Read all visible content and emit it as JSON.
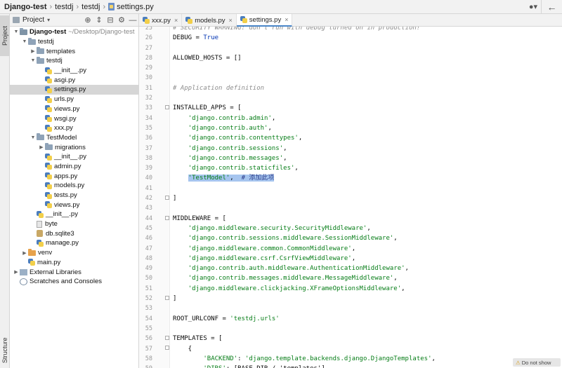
{
  "breadcrumb": [
    {
      "label": "Django-test",
      "bold": true
    },
    {
      "label": "testdj"
    },
    {
      "label": "testdj"
    },
    {
      "label": "settings.py",
      "file": true
    }
  ],
  "stripe": {
    "project_tab": "Project",
    "structure_tab": "Structure"
  },
  "panel": {
    "title": "Project"
  },
  "tree": [
    {
      "depth": 0,
      "arrow": "down",
      "icon": "folder-dark",
      "label": "Django-test",
      "bold": true,
      "path": "~/Desktop/Django-test"
    },
    {
      "depth": 1,
      "arrow": "down",
      "icon": "folder",
      "label": "testdj"
    },
    {
      "depth": 2,
      "arrow": "right",
      "icon": "folder",
      "label": "templates"
    },
    {
      "depth": 2,
      "arrow": "down",
      "icon": "folder",
      "label": "testdj"
    },
    {
      "depth": 3,
      "arrow": "none",
      "icon": "py",
      "label": "__init__.py"
    },
    {
      "depth": 3,
      "arrow": "none",
      "icon": "py",
      "label": "asgi.py"
    },
    {
      "depth": 3,
      "arrow": "none",
      "icon": "py",
      "label": "settings.py",
      "selected": true
    },
    {
      "depth": 3,
      "arrow": "none",
      "icon": "py",
      "label": "urls.py"
    },
    {
      "depth": 3,
      "arrow": "none",
      "icon": "py",
      "label": "views.py"
    },
    {
      "depth": 3,
      "arrow": "none",
      "icon": "py",
      "label": "wsgi.py"
    },
    {
      "depth": 3,
      "arrow": "none",
      "icon": "py",
      "label": "xxx.py"
    },
    {
      "depth": 2,
      "arrow": "down",
      "icon": "folder",
      "label": "TestModel"
    },
    {
      "depth": 3,
      "arrow": "right",
      "icon": "folder",
      "label": "migrations"
    },
    {
      "depth": 3,
      "arrow": "none",
      "icon": "py",
      "label": "__init__.py"
    },
    {
      "depth": 3,
      "arrow": "none",
      "icon": "py",
      "label": "admin.py"
    },
    {
      "depth": 3,
      "arrow": "none",
      "icon": "py",
      "label": "apps.py"
    },
    {
      "depth": 3,
      "arrow": "none",
      "icon": "py",
      "label": "models.py"
    },
    {
      "depth": 3,
      "arrow": "none",
      "icon": "py",
      "label": "tests.py"
    },
    {
      "depth": 3,
      "arrow": "none",
      "icon": "py",
      "label": "views.py"
    },
    {
      "depth": 2,
      "arrow": "none",
      "icon": "py",
      "label": "__init__.py"
    },
    {
      "depth": 2,
      "arrow": "none",
      "icon": "file",
      "label": "byte"
    },
    {
      "depth": 2,
      "arrow": "none",
      "icon": "db",
      "label": "db.sqlite3"
    },
    {
      "depth": 2,
      "arrow": "none",
      "icon": "py",
      "label": "manage.py"
    },
    {
      "depth": 1,
      "arrow": "right",
      "icon": "folder-excluded",
      "label": "venv"
    },
    {
      "depth": 1,
      "arrow": "none",
      "icon": "py",
      "label": "main.py"
    },
    {
      "depth": 0,
      "arrow": "right",
      "icon": "lib",
      "label": "External Libraries"
    },
    {
      "depth": 0,
      "arrow": "none",
      "icon": "scratch",
      "label": "Scratches and Consoles"
    }
  ],
  "tabs": [
    {
      "label": "xxx.py"
    },
    {
      "label": "models.py"
    },
    {
      "label": "settings.py",
      "active": true
    }
  ],
  "editor": {
    "lines": [
      {
        "n": "25",
        "parts": [
          [
            "cmt",
            "# SECURITY WARNING: don't run with debug turned on in production!"
          ]
        ]
      },
      {
        "n": "26",
        "parts": [
          [
            "",
            "DEBUG = "
          ],
          [
            "kw",
            "True"
          ]
        ]
      },
      {
        "n": "27",
        "parts": []
      },
      {
        "n": "28",
        "parts": [
          [
            "",
            "ALLOWED_HOSTS = []"
          ]
        ]
      },
      {
        "n": "29",
        "parts": []
      },
      {
        "n": "30",
        "parts": []
      },
      {
        "n": "31",
        "parts": [
          [
            "cmt",
            "# Application definition"
          ]
        ]
      },
      {
        "n": "32",
        "parts": []
      },
      {
        "n": "33",
        "parts": [
          [
            "",
            "INSTALLED_APPS = ["
          ]
        ]
      },
      {
        "n": "34",
        "parts": [
          [
            "",
            "    "
          ],
          [
            "str",
            "'django.contrib.admin'"
          ],
          [
            "",
            ","
          ]
        ]
      },
      {
        "n": "35",
        "parts": [
          [
            "",
            "    "
          ],
          [
            "str",
            "'django.contrib.auth'"
          ],
          [
            "",
            ","
          ]
        ]
      },
      {
        "n": "36",
        "parts": [
          [
            "",
            "    "
          ],
          [
            "str",
            "'django.contrib.contenttypes'"
          ],
          [
            "",
            ","
          ]
        ]
      },
      {
        "n": "37",
        "parts": [
          [
            "",
            "    "
          ],
          [
            "str",
            "'django.contrib.sessions'"
          ],
          [
            "",
            ","
          ]
        ]
      },
      {
        "n": "38",
        "parts": [
          [
            "",
            "    "
          ],
          [
            "str",
            "'django.contrib.messages'"
          ],
          [
            "",
            ","
          ]
        ]
      },
      {
        "n": "39",
        "parts": [
          [
            "",
            "    "
          ],
          [
            "str",
            "'django.contrib.staticfiles'"
          ],
          [
            "",
            ","
          ]
        ]
      },
      {
        "n": "40",
        "highlight": true,
        "parts": [
          [
            "",
            "    "
          ],
          [
            "hlstart",
            ""
          ],
          [
            "str",
            "'TestModel'"
          ],
          [
            "",
            ",  "
          ],
          [
            "cmt",
            "# 添加此项"
          ]
        ]
      },
      {
        "n": "41",
        "parts": []
      },
      {
        "n": "42",
        "parts": [
          [
            "",
            "]"
          ]
        ]
      },
      {
        "n": "43",
        "parts": []
      },
      {
        "n": "44",
        "parts": [
          [
            "",
            "MIDDLEWARE = ["
          ]
        ]
      },
      {
        "n": "45",
        "parts": [
          [
            "",
            "    "
          ],
          [
            "str",
            "'django.middleware.security.SecurityMiddleware'"
          ],
          [
            "",
            ","
          ]
        ]
      },
      {
        "n": "46",
        "parts": [
          [
            "",
            "    "
          ],
          [
            "str",
            "'django.contrib.sessions.middleware.SessionMiddleware'"
          ],
          [
            "",
            ","
          ]
        ]
      },
      {
        "n": "47",
        "parts": [
          [
            "",
            "    "
          ],
          [
            "str",
            "'django.middleware.common.CommonMiddleware'"
          ],
          [
            "",
            ","
          ]
        ]
      },
      {
        "n": "48",
        "parts": [
          [
            "",
            "    "
          ],
          [
            "str",
            "'django.middleware.csrf.CsrfViewMiddleware'"
          ],
          [
            "",
            ","
          ]
        ]
      },
      {
        "n": "49",
        "parts": [
          [
            "",
            "    "
          ],
          [
            "str",
            "'django.contrib.auth.middleware.AuthenticationMiddleware'"
          ],
          [
            "",
            ","
          ]
        ]
      },
      {
        "n": "50",
        "parts": [
          [
            "",
            "    "
          ],
          [
            "str",
            "'django.contrib.messages.middleware.MessageMiddleware'"
          ],
          [
            "",
            ","
          ]
        ]
      },
      {
        "n": "51",
        "parts": [
          [
            "",
            "    "
          ],
          [
            "str",
            "'django.middleware.clickjacking.XFrameOptionsMiddleware'"
          ],
          [
            "",
            ","
          ]
        ]
      },
      {
        "n": "52",
        "parts": [
          [
            "",
            "]"
          ]
        ]
      },
      {
        "n": "53",
        "parts": []
      },
      {
        "n": "54",
        "parts": [
          [
            "",
            "ROOT_URLCONF = "
          ],
          [
            "str",
            "'testdj.urls'"
          ]
        ]
      },
      {
        "n": "55",
        "parts": []
      },
      {
        "n": "56",
        "parts": [
          [
            "",
            "TEMPLATES = ["
          ]
        ]
      },
      {
        "n": "57",
        "parts": [
          [
            "",
            "    {"
          ]
        ]
      },
      {
        "n": "58",
        "parts": [
          [
            "",
            "        "
          ],
          [
            "str",
            "'BACKEND'"
          ],
          [
            "",
            ": "
          ],
          [
            "str",
            "'django.template.backends.django.DjangoTemplates'"
          ],
          [
            "",
            ","
          ]
        ]
      },
      {
        "n": "59",
        "parts": [
          [
            "",
            "        "
          ],
          [
            "str",
            "'DIRS'"
          ],
          [
            "",
            ": [BASE_DIR / 'templates'],"
          ]
        ]
      }
    ]
  },
  "warning_pill": "Do not show"
}
